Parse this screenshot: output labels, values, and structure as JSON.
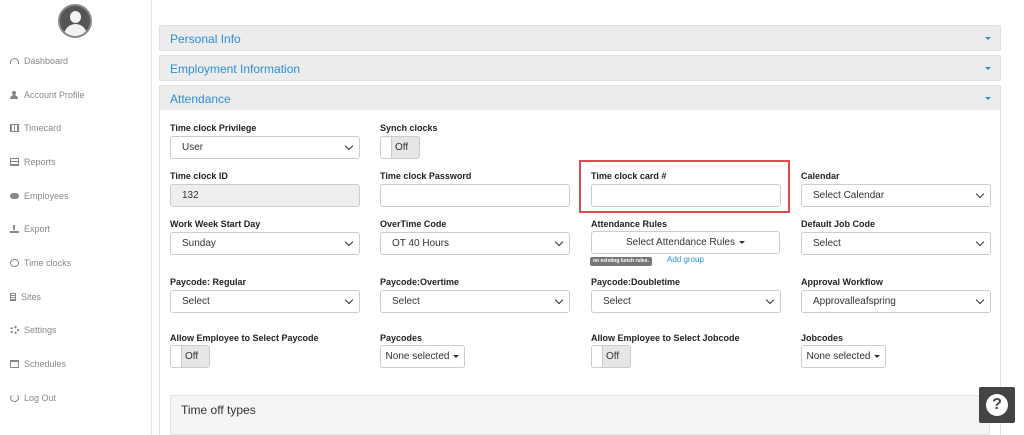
{
  "sidebar": {
    "items": [
      {
        "label": "Dashboard",
        "icon": "dashboard-icon"
      },
      {
        "label": "Account Profile",
        "icon": "user-icon"
      },
      {
        "label": "Timecard",
        "icon": "table-icon"
      },
      {
        "label": "Reports",
        "icon": "report-icon"
      },
      {
        "label": "Employees",
        "icon": "users-icon"
      },
      {
        "label": "Export",
        "icon": "download-icon"
      },
      {
        "label": "Time clocks",
        "icon": "clock-icon"
      },
      {
        "label": "Sites",
        "icon": "building-icon"
      },
      {
        "label": "Settings",
        "icon": "gear-icon"
      },
      {
        "label": "Schedules",
        "icon": "calendar-icon"
      },
      {
        "label": "Log Out",
        "icon": "power-icon"
      }
    ]
  },
  "panels": {
    "personal": "Personal Info",
    "employment": "Employment Information",
    "attendance": "Attendance"
  },
  "form": {
    "time_clock_privilege": {
      "label": "Time clock Privilege",
      "value": "User"
    },
    "synch_clocks": {
      "label": "Synch clocks",
      "value": "Off"
    },
    "time_clock_id": {
      "label": "Time clock ID",
      "value": "132"
    },
    "time_clock_password": {
      "label": "Time clock Password",
      "value": ""
    },
    "time_clock_card": {
      "label": "Time clock card #",
      "value": ""
    },
    "calendar": {
      "label": "Calendar",
      "value": "Select Calendar"
    },
    "work_week_start": {
      "label": "Work Week Start Day",
      "value": "Sunday"
    },
    "overtime_code": {
      "label": "OverTime Code",
      "value": "OT 40 Hours"
    },
    "attendance_rules": {
      "label": "Attendance Rules",
      "value": "Select Attendance Rules",
      "badge": "no existing lunch rules.",
      "link": "Add group"
    },
    "default_job_code": {
      "label": "Default Job Code",
      "value": "Select"
    },
    "paycode_regular": {
      "label": "Paycode: Regular",
      "value": "Select"
    },
    "paycode_overtime": {
      "label": "Paycode:Overtime",
      "value": "Select"
    },
    "paycode_doubletime": {
      "label": "Paycode:Doubletime",
      "value": "Select"
    },
    "approval_workflow": {
      "label": "Approval Workflow",
      "value": "Approvalleafspring"
    },
    "allow_select_paycode": {
      "label": "Allow Employee to Select Paycode",
      "value": "Off"
    },
    "paycodes": {
      "label": "Paycodes",
      "value": "None selected"
    },
    "allow_select_jobcode": {
      "label": "Allow Employee to Select Jobcode",
      "value": "Off"
    },
    "jobcodes": {
      "label": "Jobcodes",
      "value": "None selected"
    }
  },
  "time_off": {
    "title": "Time off types"
  },
  "help": {
    "glyph": "?"
  },
  "colors": {
    "accent": "#2b8fd4",
    "highlight": "#e04a4a",
    "panel_bg": "#ececec"
  }
}
